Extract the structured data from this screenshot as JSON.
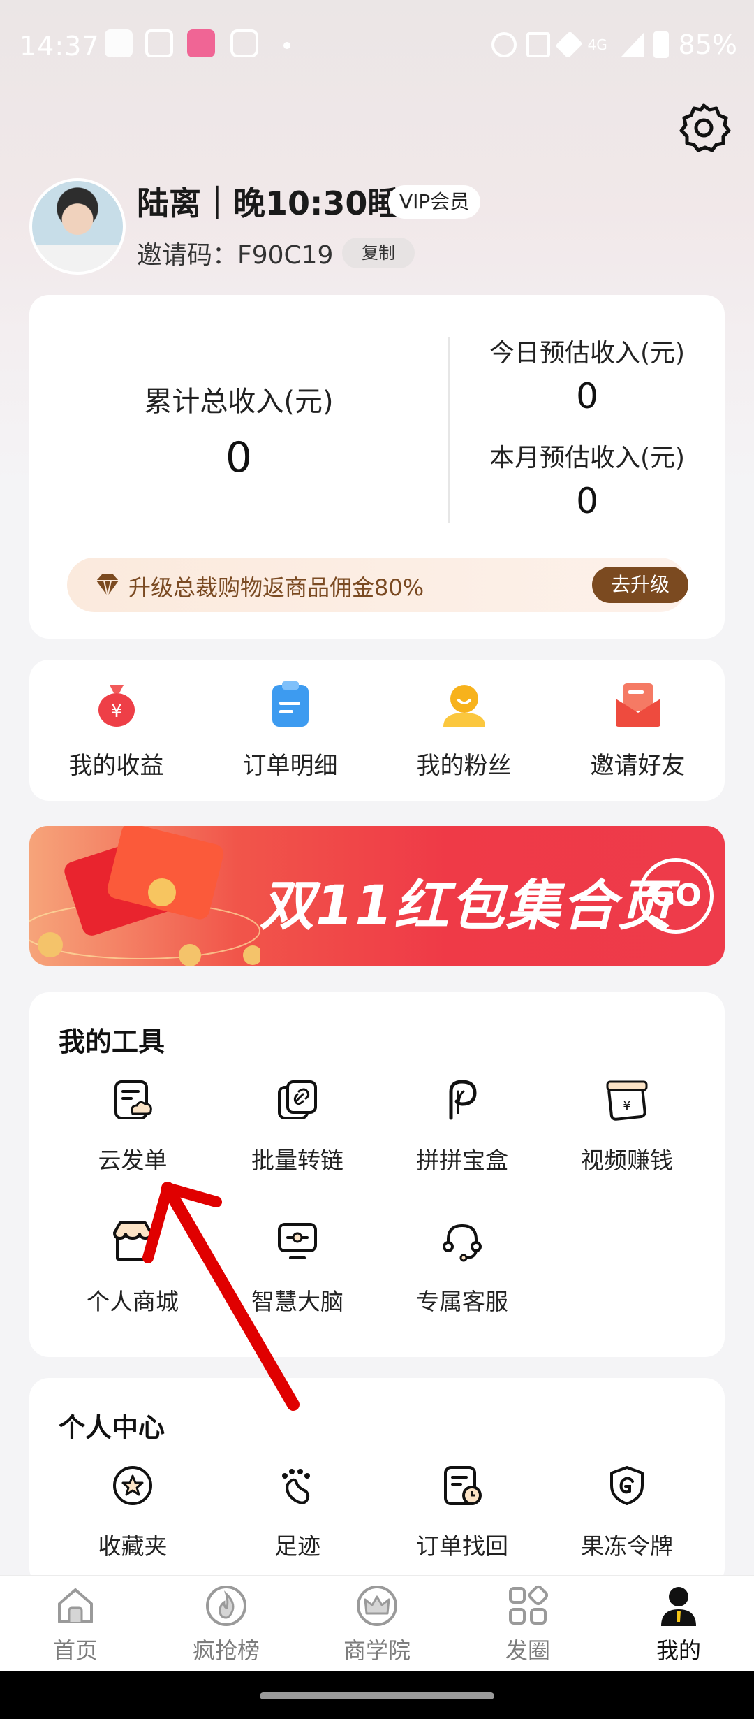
{
  "status_bar": {
    "time": "14:37",
    "battery": "85%",
    "network": "4G"
  },
  "profile": {
    "name": "陆离｜晚10:30睡",
    "vip_badge": "VIP会员",
    "invite_label": "邀请码：F90C19",
    "copy_label": "复制"
  },
  "income": {
    "total_label": "累计总收入(元)",
    "total_value": "0",
    "today_label": "今日预估收入(元)",
    "today_value": "0",
    "month_label": "本月预估收入(元)",
    "month_value": "0",
    "upgrade_text": "升级总裁购物返商品佣金80%",
    "upgrade_button": "去升级"
  },
  "quick_actions": [
    {
      "label": "我的收益",
      "icon": "money-bag-icon"
    },
    {
      "label": "订单明细",
      "icon": "clipboard-icon"
    },
    {
      "label": "我的粉丝",
      "icon": "fans-icon"
    },
    {
      "label": "邀请好友",
      "icon": "envelope-icon"
    }
  ],
  "banner": {
    "title": "双11红包集合页",
    "go": "GO"
  },
  "tools": {
    "title": "我的工具",
    "items": [
      {
        "label": "云发单",
        "icon": "cloud-order-icon"
      },
      {
        "label": "批量转链",
        "icon": "link-icon"
      },
      {
        "label": "拼拼宝盒",
        "icon": "p-box-icon"
      },
      {
        "label": "视频赚钱",
        "icon": "video-money-icon"
      },
      {
        "label": "个人商城",
        "icon": "shop-icon"
      },
      {
        "label": "智慧大脑",
        "icon": "monitor-icon"
      },
      {
        "label": "专属客服",
        "icon": "headset-icon"
      }
    ]
  },
  "personal": {
    "title": "个人中心",
    "items": [
      {
        "label": "收藏夹",
        "icon": "star-icon"
      },
      {
        "label": "足迹",
        "icon": "footprint-icon"
      },
      {
        "label": "订单找回",
        "icon": "order-clock-icon"
      },
      {
        "label": "果冻令牌",
        "icon": "shield-g-icon"
      }
    ]
  },
  "nav": [
    {
      "label": "首页",
      "icon": "home-icon"
    },
    {
      "label": "疯抢榜",
      "icon": "fire-icon"
    },
    {
      "label": "商学院",
      "icon": "crown-icon"
    },
    {
      "label": "发圈",
      "icon": "grid-icon"
    },
    {
      "label": "我的",
      "icon": "user-icon",
      "active": true
    }
  ],
  "colors": {
    "accent_brown": "#7b4a20",
    "banner_red": "#ef3a47",
    "annotation_red": "#e00000"
  }
}
